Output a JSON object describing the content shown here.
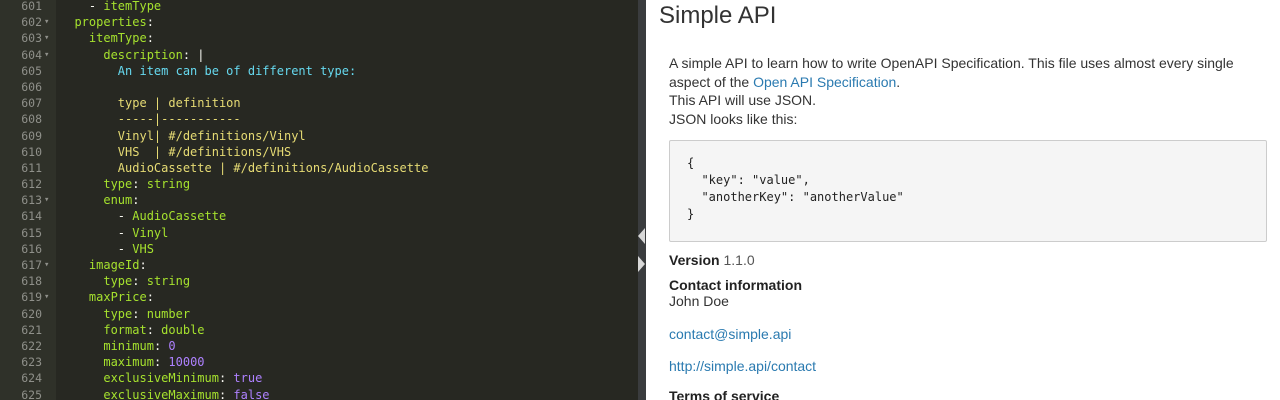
{
  "editor": {
    "lines": [
      {
        "num": "601",
        "fold": "",
        "tokens": [
          {
            "t": "    - ",
            "c": "p"
          },
          {
            "t": "itemType",
            "c": "k"
          }
        ]
      },
      {
        "num": "602",
        "fold": "▾",
        "tokens": [
          {
            "t": "  ",
            "c": "p"
          },
          {
            "t": "properties",
            "c": "k"
          },
          {
            "t": ":",
            "c": "p"
          }
        ]
      },
      {
        "num": "603",
        "fold": "▾",
        "tokens": [
          {
            "t": "    ",
            "c": "p"
          },
          {
            "t": "itemType",
            "c": "k"
          },
          {
            "t": ":",
            "c": "p"
          }
        ]
      },
      {
        "num": "604",
        "fold": "▾",
        "tokens": [
          {
            "t": "      ",
            "c": "p"
          },
          {
            "t": "description",
            "c": "k"
          },
          {
            "t": ": |",
            "c": "p"
          }
        ]
      },
      {
        "num": "605",
        "fold": "",
        "tokens": [
          {
            "t": "        An item can be of different type:",
            "c": "c"
          }
        ]
      },
      {
        "num": "606",
        "fold": "",
        "tokens": [
          {
            "t": "",
            "c": "p"
          }
        ]
      },
      {
        "num": "607",
        "fold": "",
        "tokens": [
          {
            "t": "        type | definition",
            "c": "s"
          }
        ]
      },
      {
        "num": "608",
        "fold": "",
        "tokens": [
          {
            "t": "        -----|-----------",
            "c": "s"
          }
        ]
      },
      {
        "num": "609",
        "fold": "",
        "tokens": [
          {
            "t": "        Vinyl| #/definitions/Vinyl",
            "c": "s"
          }
        ]
      },
      {
        "num": "610",
        "fold": "",
        "tokens": [
          {
            "t": "        VHS  | #/definitions/VHS",
            "c": "s"
          }
        ]
      },
      {
        "num": "611",
        "fold": "",
        "tokens": [
          {
            "t": "        AudioCassette | #/definitions/AudioCassette",
            "c": "s"
          }
        ]
      },
      {
        "num": "612",
        "fold": "",
        "tokens": [
          {
            "t": "      ",
            "c": "p"
          },
          {
            "t": "type",
            "c": "k"
          },
          {
            "t": ": ",
            "c": "p"
          },
          {
            "t": "string",
            "c": "v"
          }
        ]
      },
      {
        "num": "613",
        "fold": "▾",
        "tokens": [
          {
            "t": "      ",
            "c": "p"
          },
          {
            "t": "enum",
            "c": "k"
          },
          {
            "t": ":",
            "c": "p"
          }
        ]
      },
      {
        "num": "614",
        "fold": "",
        "tokens": [
          {
            "t": "        - ",
            "c": "p"
          },
          {
            "t": "AudioCassette",
            "c": "v"
          }
        ]
      },
      {
        "num": "615",
        "fold": "",
        "tokens": [
          {
            "t": "        - ",
            "c": "p"
          },
          {
            "t": "Vinyl",
            "c": "v"
          }
        ]
      },
      {
        "num": "616",
        "fold": "",
        "tokens": [
          {
            "t": "        - ",
            "c": "p"
          },
          {
            "t": "VHS",
            "c": "v"
          }
        ]
      },
      {
        "num": "617",
        "fold": "▾",
        "tokens": [
          {
            "t": "    ",
            "c": "p"
          },
          {
            "t": "imageId",
            "c": "k"
          },
          {
            "t": ":",
            "c": "p"
          }
        ]
      },
      {
        "num": "618",
        "fold": "",
        "tokens": [
          {
            "t": "      ",
            "c": "p"
          },
          {
            "t": "type",
            "c": "k"
          },
          {
            "t": ": ",
            "c": "p"
          },
          {
            "t": "string",
            "c": "v"
          }
        ]
      },
      {
        "num": "619",
        "fold": "▾",
        "tokens": [
          {
            "t": "    ",
            "c": "p"
          },
          {
            "t": "maxPrice",
            "c": "k"
          },
          {
            "t": ":",
            "c": "p"
          }
        ]
      },
      {
        "num": "620",
        "fold": "",
        "tokens": [
          {
            "t": "      ",
            "c": "p"
          },
          {
            "t": "type",
            "c": "k"
          },
          {
            "t": ": ",
            "c": "p"
          },
          {
            "t": "number",
            "c": "v"
          }
        ]
      },
      {
        "num": "621",
        "fold": "",
        "tokens": [
          {
            "t": "      ",
            "c": "p"
          },
          {
            "t": "format",
            "c": "k"
          },
          {
            "t": ": ",
            "c": "p"
          },
          {
            "t": "double",
            "c": "v"
          }
        ]
      },
      {
        "num": "622",
        "fold": "",
        "tokens": [
          {
            "t": "      ",
            "c": "p"
          },
          {
            "t": "minimum",
            "c": "k"
          },
          {
            "t": ": ",
            "c": "p"
          },
          {
            "t": "0",
            "c": "n"
          }
        ]
      },
      {
        "num": "623",
        "fold": "",
        "tokens": [
          {
            "t": "      ",
            "c": "p"
          },
          {
            "t": "maximum",
            "c": "k"
          },
          {
            "t": ": ",
            "c": "p"
          },
          {
            "t": "10000",
            "c": "n"
          }
        ]
      },
      {
        "num": "624",
        "fold": "",
        "tokens": [
          {
            "t": "      ",
            "c": "p"
          },
          {
            "t": "exclusiveMinimum",
            "c": "k"
          },
          {
            "t": ": ",
            "c": "p"
          },
          {
            "t": "true",
            "c": "n"
          }
        ]
      },
      {
        "num": "625",
        "fold": "",
        "tokens": [
          {
            "t": "      ",
            "c": "p"
          },
          {
            "t": "exclusiveMaximum",
            "c": "k"
          },
          {
            "t": ": ",
            "c": "p"
          },
          {
            "t": "false",
            "c": "n"
          }
        ]
      }
    ]
  },
  "preview": {
    "title": "Simple API",
    "description_line1": "A simple API to learn how to write OpenAPI Specification. This file uses almost every single",
    "description_line2_prefix": "aspect of the ",
    "description_link": "Open API Specification",
    "description_line2_suffix": ".",
    "description_line3": "This API will use JSON.",
    "description_line4": "JSON looks like this:",
    "code_sample": "{\n  \"key\": \"value\",\n  \"anotherKey\": \"anotherValue\"\n}",
    "version_label": "Version",
    "version_value": " 1.1.0",
    "contact_heading": "Contact information",
    "contact_name": "John Doe",
    "contact_email": "contact@simple.api",
    "contact_url": "http://simple.api/contact",
    "tos_heading": "Terms of service"
  },
  "colors": {
    "editor_bg": "#272822",
    "key": "#a6e22e",
    "string": "#e6db74",
    "comment_text": "#66d9ef",
    "number": "#ae81ff",
    "link": "#2a7ab0"
  }
}
